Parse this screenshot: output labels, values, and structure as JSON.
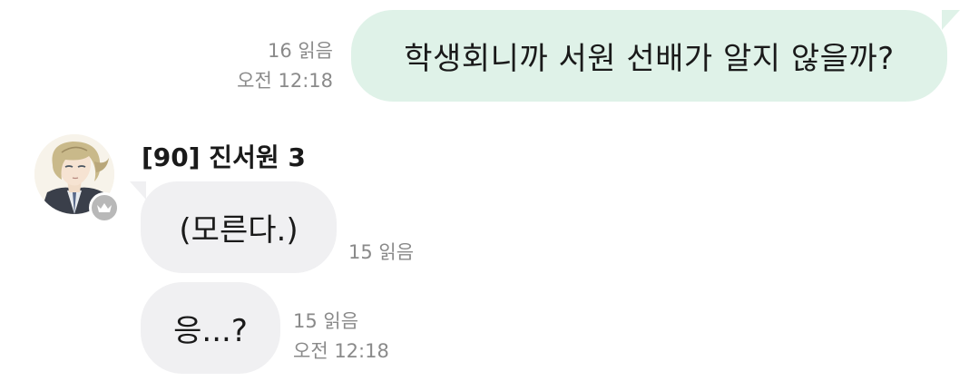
{
  "outgoing": {
    "text": "학생회니까 서원 선배가 알지 않을까?",
    "read_count": "16 읽음",
    "time": "오전 12:18"
  },
  "sender": {
    "name": "[90] 진서원 3",
    "badge_icon": "crown-icon"
  },
  "incoming": [
    {
      "text": "(모른다.)",
      "read_count": "15 읽음"
    },
    {
      "text": "응...?",
      "read_count": "15 읽음",
      "time": "오전 12:18"
    }
  ],
  "colors": {
    "outgoing_bubble": "#dff2e8",
    "incoming_bubble": "#f0f0f2",
    "meta_text": "#8a8a8a",
    "badge": "#b8b8b8"
  }
}
